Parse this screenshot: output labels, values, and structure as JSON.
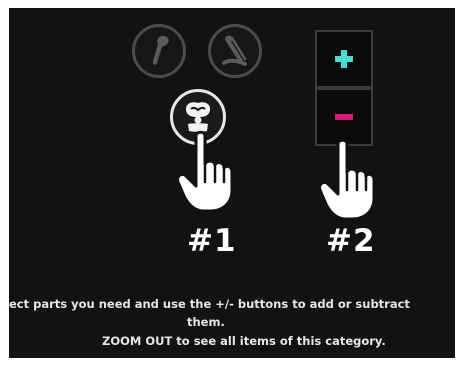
{
  "category_icons": [
    {
      "name": "arm-bone-icon",
      "state": "inactive"
    },
    {
      "name": "leg-bone-icon",
      "state": "inactive"
    },
    {
      "name": "knee-joint-icon",
      "state": "active"
    }
  ],
  "buttons": {
    "plus_glyph": "+",
    "minus_glyph": "−",
    "plus_color": "#3ee0d8",
    "minus_color": "#e0177d"
  },
  "steps": {
    "step1": "#1",
    "step2": "#2"
  },
  "instructions": {
    "line1": "ect parts you need and use the +/- buttons to add or subtract",
    "line2": "them.",
    "line3": "ZOOM OUT to see all items of this category."
  }
}
